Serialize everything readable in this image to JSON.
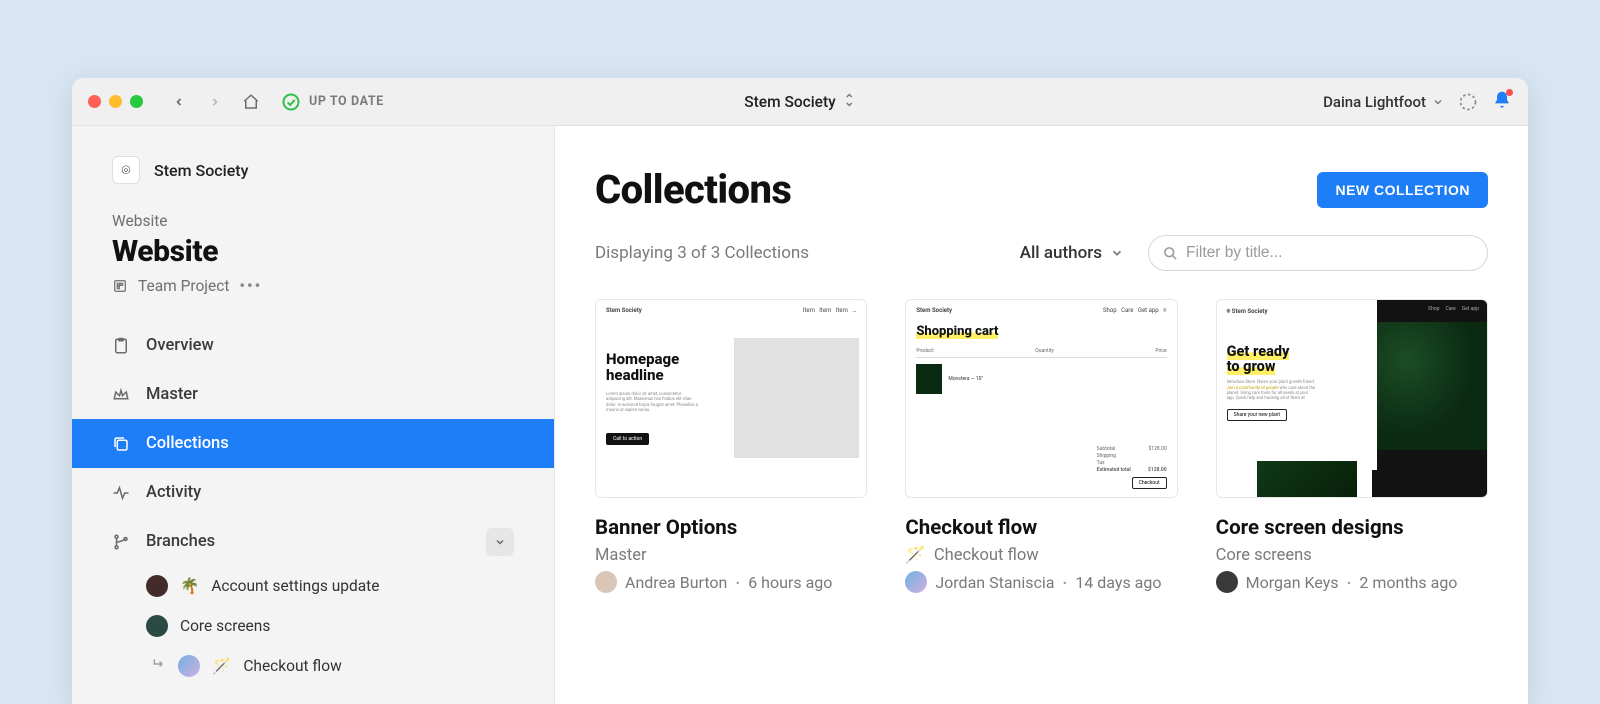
{
  "titlebar": {
    "status_label": "UP TO DATE",
    "project_title": "Stem Society",
    "user_name": "Daina Lightfoot"
  },
  "sidebar": {
    "org_name": "Stem Society",
    "org_logo_emoji": "⌾",
    "breadcrumb": "Website",
    "title": "Website",
    "meta_label": "Team Project",
    "nav": {
      "overview": "Overview",
      "master": "Master",
      "collections": "Collections",
      "activity": "Activity",
      "branches": "Branches"
    },
    "branches": [
      {
        "emoji": "🌴",
        "label": "Account settings update"
      },
      {
        "emoji": "",
        "label": "Core screens"
      },
      {
        "emoji": "🪄",
        "label": "Checkout flow"
      }
    ]
  },
  "main": {
    "heading": "Collections",
    "new_btn": "NEW COLLECTION",
    "count_text": "Displaying 3 of 3 Collections",
    "authors_label": "All authors",
    "filter_placeholder": "Filter by title..."
  },
  "cards": [
    {
      "title": "Banner Options",
      "branch": "Master",
      "branch_emoji": "",
      "author": "Andrea Burton",
      "time": "6 hours ago",
      "thumb_headline": "Homepage headline",
      "thumb_cta": "Call to action"
    },
    {
      "title": "Checkout flow",
      "branch": "Checkout flow",
      "branch_emoji": "🪄",
      "author": "Jordan Staniscia",
      "time": "14 days ago",
      "thumb_headline": "Shopping cart",
      "thumb_checkout": "Checkout"
    },
    {
      "title": "Core screen designs",
      "branch": "Core screens",
      "branch_emoji": "",
      "author": "Morgan Keys",
      "time": "2 months ago",
      "thumb_headline_l1": "Get ready",
      "thumb_headline_l2": "to grow",
      "thumb_cta": "Share your new plant"
    }
  ]
}
